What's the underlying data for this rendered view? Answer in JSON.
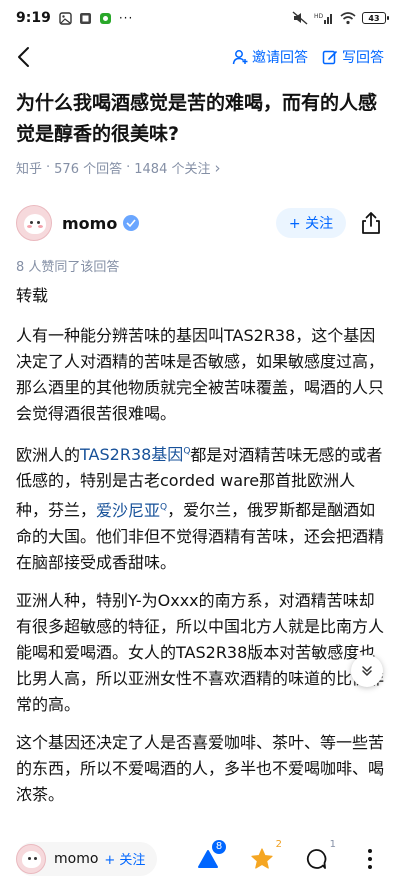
{
  "status_bar": {
    "time": "9:19",
    "battery": "43"
  },
  "nav": {
    "invite_label": "邀请回答",
    "write_label": "写回答"
  },
  "question": {
    "title": "为什么我喝酒感觉是苦的难喝，而有的人感觉是醇香的很美味?",
    "source": "知乎",
    "answers": "576 个回答",
    "followers": "1484 个关注",
    "sep": "·",
    "arrow": "›"
  },
  "author": {
    "name": "momo",
    "follow_label": "+ 关注"
  },
  "endorse": "8 人赞同了该回答",
  "article": {
    "repost": "转载",
    "p1": "人有一种能分辨苦味的基因叫TAS2R38，这个基因决定了人对酒精的苦味是否敏感，如果敏感度过高，那么酒里的其他物质就完全被苦味覆盖，喝酒的人只会觉得酒很苦很难喝。",
    "p2_a": "欧洲人的",
    "p2_kw1": "TAS2R38基因",
    "p2_b": "都是对酒精苦味无感的或者低感的，特别是古老corded ware那首批欧洲人种，芬兰，",
    "p2_kw2": "爱沙尼亚",
    "p2_c": "，爱尔兰，俄罗斯都是酗酒如命的大国。他们非但不觉得酒精有苦味，还会把酒精在脑部接受成香甜味。",
    "p3": "亚洲人种，特别Y-为Oxxx的南方系，对酒精苦味却有很多超敏感的特征，所以中国北方人就是比南方人能喝和爱喝酒。女人的TAS2R38版本对苦敏感度也比男人高，所以亚洲女性不喜欢酒精的味道的比例非常的高。",
    "p4": "这个基因还决定了人是否喜爱咖啡、茶叶、等一些苦的东西，所以不爱喝酒的人，多半也不爱喝咖啡、喝浓茶。",
    "kw_mark": "Q"
  },
  "bottom_bar": {
    "author_name": "momo",
    "follow_label": "+ 关注",
    "upvote_count": "8",
    "star_count": "2",
    "comment_count": "1"
  },
  "colors": {
    "accent": "#0066ff",
    "keyword": "#175199",
    "meta": "#8590a6",
    "follow_bg": "#ebf5ff",
    "star": "#f5a623"
  }
}
